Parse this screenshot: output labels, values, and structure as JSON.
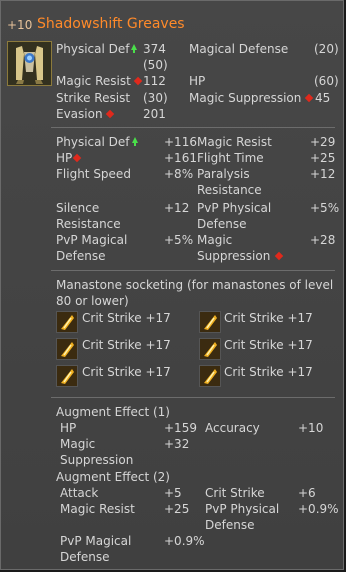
{
  "item": {
    "enchant": "+10",
    "name": "Shadowshift Greaves",
    "icon": "greaves-icon"
  },
  "base_stats": {
    "physical_def_label": "Physical Def",
    "physical_def_value": "374",
    "physical_def_base": "(50)",
    "magical_defense_label": "Magical Defense",
    "magical_defense_value": "(20)",
    "magic_resist_label": "Magic Resist",
    "magic_resist_value": "112",
    "hp_label": "HP",
    "hp_value": "(60)",
    "strike_resist_label": "Strike Resist",
    "strike_resist_value": "(30)",
    "magic_suppression_label": "Magic Suppression",
    "magic_suppression_value": "45",
    "evasion_label": "Evasion",
    "evasion_value": "201"
  },
  "bonus_stats": {
    "physical_def_label": "Physical Def",
    "physical_def_value": "+116",
    "magic_resist_label": "Magic Resist",
    "magic_resist_value": "+29",
    "hp_label": "HP",
    "hp_value": "+161",
    "flight_time_label": "Flight Time",
    "flight_time_value": "+25",
    "flight_speed_label": "Flight Speed",
    "flight_speed_value": "+8%",
    "paralysis_label_1": "Paralysis",
    "paralysis_label_2": "Resistance",
    "paralysis_value": "+12",
    "silence_label_1": "Silence",
    "silence_label_2": "Resistance",
    "silence_value": "+12",
    "pvp_phys_label_1": "PvP Physical",
    "pvp_phys_label_2": "Defense",
    "pvp_phys_value": "+5%",
    "pvp_mag_label_1": "PvP Magical",
    "pvp_mag_label_2": "Defense",
    "pvp_mag_value": "+5%",
    "magic_supp_label_1": "Magic",
    "magic_supp_label_2": "Suppression",
    "magic_supp_value": "+28"
  },
  "manastones": {
    "header_1": "Manastone socketing (for manastones of level",
    "header_2": "80 or lower)",
    "slots": [
      {
        "label": "Crit Strike +17"
      },
      {
        "label": "Crit Strike +17"
      },
      {
        "label": "Crit Strike +17"
      },
      {
        "label": "Crit Strike +17"
      },
      {
        "label": "Crit Strike +17"
      },
      {
        "label": "Crit Strike +17"
      }
    ]
  },
  "augment1": {
    "title": "Augment Effect (1)",
    "hp_label": "HP",
    "hp_value": "+159",
    "accuracy_label": "Accuracy",
    "accuracy_value": "+10",
    "magic_supp_label_1": "Magic",
    "magic_supp_label_2": "Suppression",
    "magic_supp_value": "+32"
  },
  "augment2": {
    "title": "Augment Effect (2)",
    "attack_label": "Attack",
    "attack_value": "+5",
    "crit_label": "Crit Strike",
    "crit_value": "+6",
    "magic_resist_label": "Magic Resist",
    "magic_resist_value": "+25",
    "pvp_phys_label_1": "PvP Physical",
    "pvp_phys_label_2": "Defense",
    "pvp_phys_value": "+0.9%",
    "pvp_mag_label_1": "PvP Magical",
    "pvp_mag_label_2": "Defense",
    "pvp_mag_value": "+0.9%"
  },
  "colors": {
    "name": "#ff8a2a",
    "enchant": "#e7c29a",
    "up_arrow": "#4adf4a",
    "debuff_marker": "#e0291c"
  }
}
